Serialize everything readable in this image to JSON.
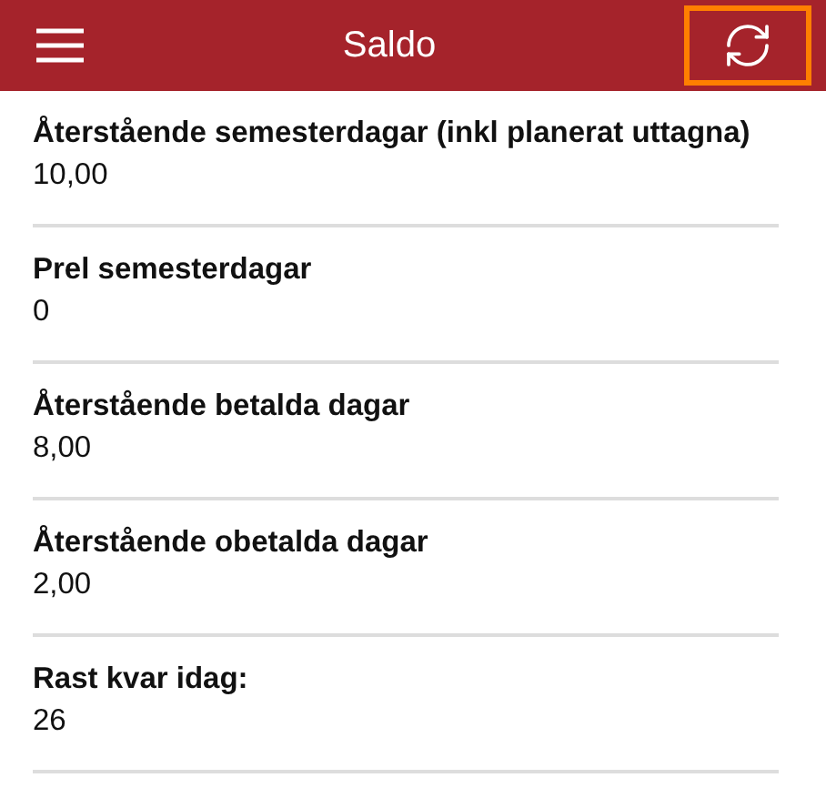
{
  "header": {
    "title": "Saldo",
    "refresh_highlighted": true
  },
  "balances": [
    {
      "label": "Återstående semesterdagar (inkl planerat uttagna)",
      "value": "10,00"
    },
    {
      "label": "Prel semesterdagar",
      "value": "0"
    },
    {
      "label": "Återstående betalda dagar",
      "value": "8,00"
    },
    {
      "label": "Återstående obetalda dagar",
      "value": "2,00"
    },
    {
      "label": "Rast kvar idag:",
      "value": "26"
    }
  ]
}
